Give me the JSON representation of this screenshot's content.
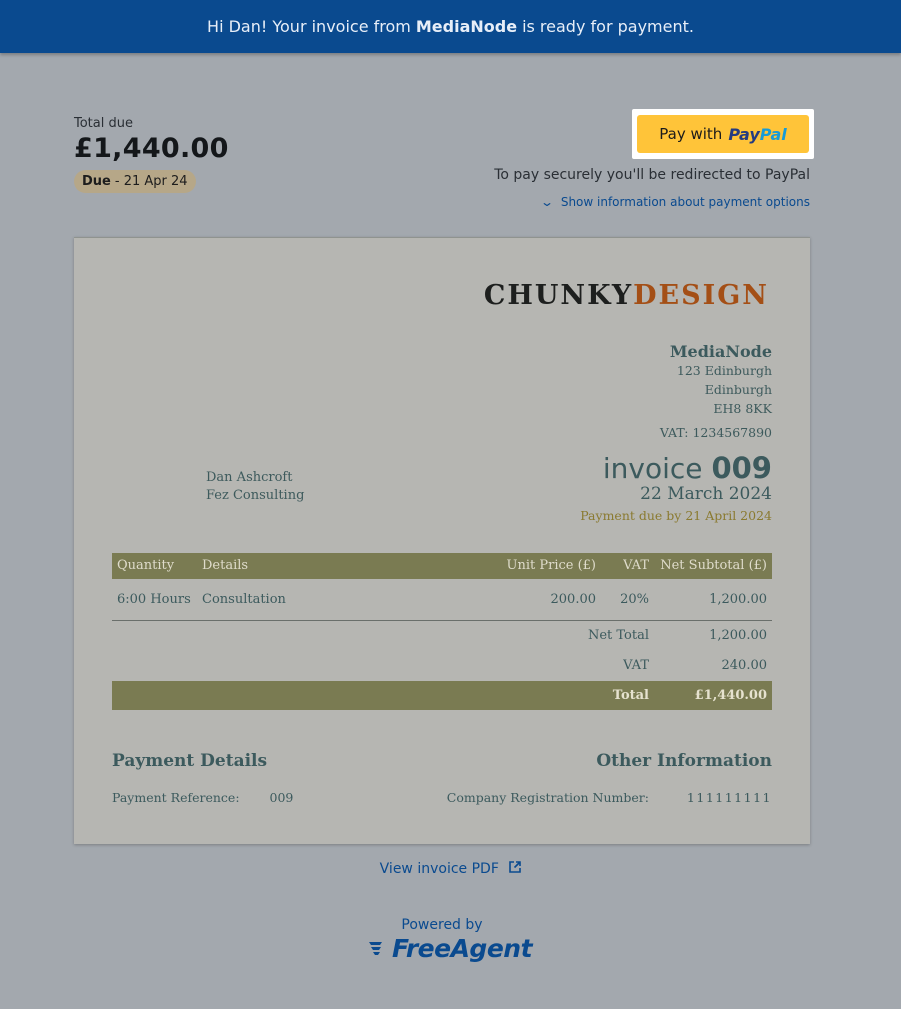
{
  "banner": {
    "prefix": "Hi Dan! Your invoice from",
    "company": "MediaNode",
    "suffix": "is ready for payment."
  },
  "summary": {
    "total_label": "Total due",
    "total_amount": "£1,440.00",
    "due_label": "Due",
    "due_date": "- 21 Apr 24"
  },
  "paypal": {
    "button_prefix": "Pay with",
    "brand_pay": "Pay",
    "brand_pal": "Pal",
    "redirect_text": "To pay securely you'll be redirected to PayPal",
    "show_info_label": "Show information about payment options"
  },
  "invoice": {
    "logo_part1": "CHUNKY",
    "logo_part2": "DESIGN",
    "company": {
      "name": "MediaNode",
      "address": [
        "123 Edinburgh",
        "Edinburgh",
        "EH8 8KK"
      ],
      "vat": "VAT: 1234567890"
    },
    "client": {
      "name": "Dan Ashcroft",
      "company": "Fez Consulting"
    },
    "title_word": "invoice",
    "number": "009",
    "date": "22 March 2024",
    "payment_due": "Payment due by 21 April 2024",
    "table": {
      "headers": {
        "quantity": "Quantity",
        "details": "Details",
        "unit_price": "Unit Price (£)",
        "vat": "VAT",
        "net_subtotal": "Net Subtotal (£)"
      },
      "rows": [
        {
          "quantity": "6:00 Hours",
          "details": "Consultation",
          "unit_price": "200.00",
          "vat": "20%",
          "net_subtotal": "1,200.00"
        }
      ],
      "net_total_label": "Net Total",
      "net_total": "1,200.00",
      "vat_label": "VAT",
      "vat_total": "240.00",
      "total_label": "Total",
      "total": "£1,440.00"
    },
    "payment_details": {
      "heading": "Payment Details",
      "ref_label": "Payment Reference:",
      "ref_value": "009"
    },
    "other_info": {
      "heading": "Other Information",
      "reg_label": "Company Registration Number:",
      "reg_value": "111111111"
    }
  },
  "footer": {
    "pdf_link": "View invoice PDF",
    "powered_by": "Powered by",
    "brand": "FreeAgent"
  },
  "colors": {
    "banner": "#0a4a8f",
    "background": "#a3a8ae",
    "paypal_yellow": "#ffc439",
    "table_header": "#7a7b52",
    "logo_accent": "#a44f16"
  },
  "icons": [
    "chevron-down-icon",
    "external-link-icon",
    "freeagent-wing-icon"
  ]
}
